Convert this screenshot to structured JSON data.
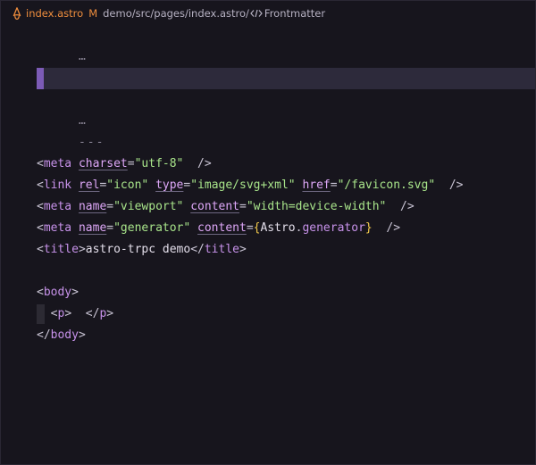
{
  "breadcrumb": {
    "file_icon": "astro-icon",
    "filename": "index.astro",
    "modified_badge": "M",
    "path": "demo/src/pages/index.astro/",
    "symbol_icon": "code-icon",
    "symbol": "Frontmatter"
  },
  "editor": {
    "lines": {
      "folded1": "…",
      "fence1": "---",
      "folded2": "…",
      "fence2": "---",
      "meta1": {
        "open": "<",
        "tag": "meta",
        "attr1": "charset",
        "eq1": "=",
        "val1": "\"utf-8\"",
        "close": "/>"
      },
      "link": {
        "open": "<",
        "tag": "link",
        "attr1": "rel",
        "val1": "\"icon\"",
        "attr2": "type",
        "val2": "\"image/svg+xml\"",
        "attr3": "href",
        "val3": "\"/favicon.svg\"",
        "eq": "=",
        "close": "/>"
      },
      "meta2": {
        "open": "<",
        "tag": "meta",
        "attr1": "name",
        "val1": "\"viewport\"",
        "attr2": "content",
        "val2": "\"width=device-width\"",
        "eq": "=",
        "close": "/>"
      },
      "meta3": {
        "open": "<",
        "tag": "meta",
        "attr1": "name",
        "val1": "\"generator\"",
        "attr2": "content",
        "eq": "=",
        "brace_open": "{",
        "obj": "Astro",
        "dot": ".",
        "prop": "generator",
        "brace_close": "}",
        "close": "/>"
      },
      "title": {
        "open": "<",
        "tag": "title",
        "gt": ">",
        "text": "astro-trpc demo",
        "close_open": "</",
        "close_tag": "title",
        "close_gt": ">"
      },
      "body_open": {
        "open": "<",
        "tag": "body",
        "gt": ">"
      },
      "p": {
        "open": "<",
        "tag": "p",
        "gt": ">",
        "close_open": "</",
        "close_tag": "p",
        "close_gt": ">"
      },
      "body_close": {
        "open": "</",
        "tag": "body",
        "gt": ">"
      }
    }
  },
  "colors": {
    "background": "#17151d",
    "current_line": "#2d2a3b",
    "cursor_marker": "#7c5bb6",
    "tag": "#c792ea",
    "attribute": "#dda7f7",
    "string": "#a8e48a",
    "brace": "#f2c94c",
    "breadcrumb_file": "#ee8d3d"
  }
}
